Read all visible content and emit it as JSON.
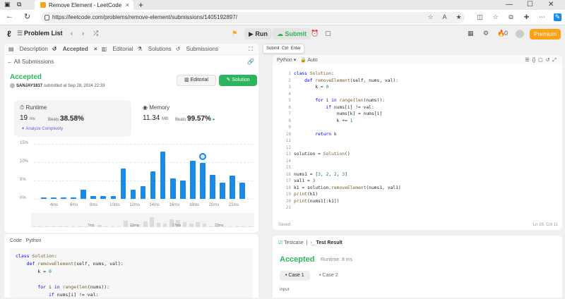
{
  "browser": {
    "tab_title": "Remove Element - LeetCode",
    "url": "https://leetcode.com/problems/remove-element/submissions/1405192897/"
  },
  "header": {
    "problem_list": "Problem List",
    "run": "Run",
    "submit": "Submit",
    "notif_count": "0",
    "premium": "Premium"
  },
  "tooltip": {
    "label": "Submit",
    "key1": "Ctrl",
    "key2": "Enter"
  },
  "left_tabs": [
    {
      "label": "Description"
    },
    {
      "label": "Accepted"
    },
    {
      "label": "Editorial"
    },
    {
      "label": "Solutions"
    },
    {
      "label": "Submissions"
    }
  ],
  "submission": {
    "back_label": "All Submissions",
    "status": "Accepted",
    "user": "SANJAY1817",
    "submitted_at": "submitted at Sep 28, 2024 22:33",
    "editorial_btn": "Editorial",
    "solution_btn": "Solution"
  },
  "runtime": {
    "label": "Runtime",
    "value": "19",
    "unit": "ms",
    "beats_label": "Beats",
    "beats": "38.58%",
    "analyze": "Analyze Complexity"
  },
  "memory": {
    "label": "Memory",
    "value": "11.34",
    "unit": "MB",
    "beats_label": "Beats",
    "beats": "99.57%"
  },
  "chart_data": {
    "type": "bar",
    "y_ticks": [
      "15%",
      "10%",
      "5%",
      "0%"
    ],
    "ylim": [
      0,
      15
    ],
    "x_tick_labels": [
      "4ms",
      "6ms",
      "8ms",
      "10ms",
      "12ms",
      "14ms",
      "16ms",
      "18ms",
      "20ms",
      "22ms"
    ],
    "bars": [
      {
        "x": 1,
        "value": 0.3
      },
      {
        "x": 2,
        "value": 0.3
      },
      {
        "x": 3,
        "value": 0.3
      },
      {
        "x": 4,
        "value": 0.3
      },
      {
        "x": 5,
        "value": 2.5
      },
      {
        "x": 6,
        "value": 0.7
      },
      {
        "x": 7,
        "value": 0.7
      },
      {
        "x": 8,
        "value": 0.7
      },
      {
        "x": 9,
        "value": 8.2
      },
      {
        "x": 10,
        "value": 2.5
      },
      {
        "x": 11,
        "value": 3.5
      },
      {
        "x": 12,
        "value": 7.5
      },
      {
        "x": 13,
        "value": 12.8
      },
      {
        "x": 14,
        "value": 5.5
      },
      {
        "x": 15,
        "value": 5.0
      },
      {
        "x": 16,
        "value": 10.3
      },
      {
        "x": 17,
        "value": 9.8
      },
      {
        "x": 18,
        "value": 6.6
      },
      {
        "x": 19,
        "value": 4.5
      },
      {
        "x": 20,
        "value": 6.3
      },
      {
        "x": 21,
        "value": 4.5
      }
    ],
    "overview_labels": [
      "7ms",
      "12ms",
      "17ms",
      "22ms"
    ]
  },
  "left_code": {
    "header_code": "Code",
    "header_lang": "Python",
    "lines": [
      "class Solution:",
      "    def removeElement(self, nums, val):",
      "        k = 0",
      "",
      "        for i in range(len(nums)):",
      "            if nums[i] != val:"
    ]
  },
  "editor": {
    "language": "Python",
    "mode": "Auto",
    "lines": [
      "class Solution:",
      "    def removeElement(self, nums, val):",
      "        k = 0",
      "",
      "        for i in range(len(nums)):",
      "            if nums[i] != val:",
      "                nums[k] = nums[i]",
      "                k += 1",
      "",
      "        return k",
      "",
      "",
      "solution = Solution()",
      "",
      "",
      "nums1 = [3, 2, 2, 3]",
      "val1 = 3",
      "k1 = solution.removeElement(nums1, val1)",
      "print(k1)",
      "print(nums1[:k1])",
      ""
    ],
    "saved": "Saved",
    "cursor": "Ln 19, Col 11"
  },
  "result": {
    "tab_testcase": "Testcase",
    "tab_result": "Test Result",
    "status": "Accepted",
    "runtime": "Runtime: 8 ms",
    "case1": "Case 1",
    "case2": "Case 2",
    "input_label": "Input"
  }
}
